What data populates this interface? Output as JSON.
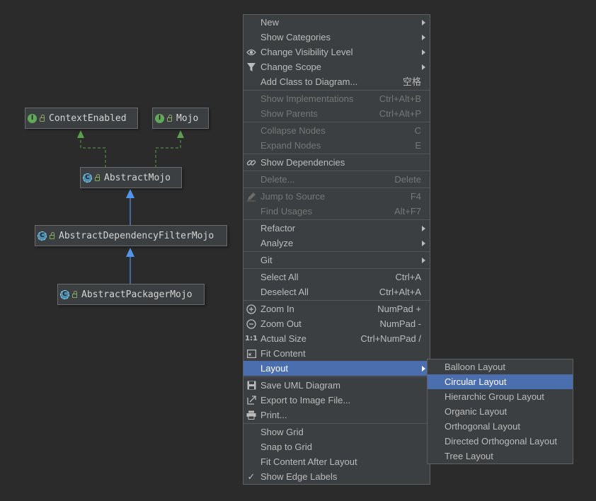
{
  "diagram": {
    "nodes": [
      {
        "id": "context",
        "name": "ContextEnabled",
        "kind": "interface",
        "badge": "I"
      },
      {
        "id": "mojo",
        "name": "Mojo",
        "kind": "interface",
        "badge": "I"
      },
      {
        "id": "abstractmojo",
        "name": "AbstractMojo",
        "kind": "abstract-class",
        "badge": "C"
      },
      {
        "id": "depfilter",
        "name": "AbstractDependencyFilterMojo",
        "kind": "abstract-class",
        "badge": "C"
      },
      {
        "id": "packager",
        "name": "AbstractPackagerMojo",
        "kind": "abstract-class",
        "badge": "C"
      }
    ],
    "colors": {
      "implements_edge": "#5b9e4d",
      "extends_edge": "#5394ec",
      "canvas": "#2b2b2b"
    }
  },
  "context_menu": {
    "items": [
      {
        "label": "New",
        "submenu": true
      },
      {
        "label": "Show Categories",
        "submenu": true
      },
      {
        "label": "Change Visibility Level",
        "icon": "eye-icon",
        "submenu": true
      },
      {
        "label": "Change Scope",
        "icon": "filter-icon",
        "submenu": true
      },
      {
        "label": "Add Class to Diagram...",
        "shortcut": "空格"
      },
      {
        "separator": true
      },
      {
        "label": "Show Implementations",
        "shortcut": "Ctrl+Alt+B",
        "disabled": true
      },
      {
        "label": "Show Parents",
        "shortcut": "Ctrl+Alt+P",
        "disabled": true
      },
      {
        "separator": true
      },
      {
        "label": "Collapse Nodes",
        "shortcut": "C",
        "disabled": true
      },
      {
        "label": "Expand Nodes",
        "shortcut": "E",
        "disabled": true
      },
      {
        "separator": true
      },
      {
        "label": "Show Dependencies",
        "icon": "link-icon"
      },
      {
        "separator": true
      },
      {
        "label": "Delete...",
        "shortcut": "Delete",
        "disabled": true
      },
      {
        "separator": true
      },
      {
        "label": "Jump to Source",
        "shortcut": "F4",
        "icon": "pencil-icon",
        "disabled": true
      },
      {
        "label": "Find Usages",
        "shortcut": "Alt+F7",
        "disabled": true
      },
      {
        "separator": true
      },
      {
        "label": "Refactor",
        "submenu": true
      },
      {
        "label": "Analyze",
        "submenu": true
      },
      {
        "separator": true
      },
      {
        "label": "Git",
        "submenu": true
      },
      {
        "separator": true
      },
      {
        "label": "Select All",
        "shortcut": "Ctrl+A"
      },
      {
        "label": "Deselect All",
        "shortcut": "Ctrl+Alt+A"
      },
      {
        "separator": true
      },
      {
        "label": "Zoom In",
        "shortcut": "NumPad +",
        "icon": "zoom-in-icon"
      },
      {
        "label": "Zoom Out",
        "shortcut": "NumPad -",
        "icon": "zoom-out-icon"
      },
      {
        "label": "Actual Size",
        "shortcut": "Ctrl+NumPad /",
        "icon": "actual-size-icon"
      },
      {
        "label": "Fit Content",
        "icon": "fit-content-icon"
      },
      {
        "label": "Layout",
        "submenu": true,
        "selected": true
      },
      {
        "separator": true
      },
      {
        "label": "Save UML Diagram",
        "icon": "save-icon"
      },
      {
        "label": "Export to Image File...",
        "icon": "export-icon"
      },
      {
        "label": "Print...",
        "icon": "print-icon"
      },
      {
        "separator": true
      },
      {
        "label": "Show Grid"
      },
      {
        "label": "Snap to Grid"
      },
      {
        "label": "Fit Content After Layout"
      },
      {
        "label": "Show Edge Labels",
        "icon": "check-icon"
      }
    ]
  },
  "layout_submenu": {
    "items": [
      {
        "label": "Balloon Layout"
      },
      {
        "label": "Circular Layout",
        "selected": true
      },
      {
        "label": "Hierarchic Group Layout"
      },
      {
        "label": "Organic Layout"
      },
      {
        "label": "Orthogonal Layout"
      },
      {
        "label": "Directed Orthogonal Layout"
      },
      {
        "label": "Tree Layout"
      }
    ]
  },
  "accent_color": "#4b6eaf"
}
